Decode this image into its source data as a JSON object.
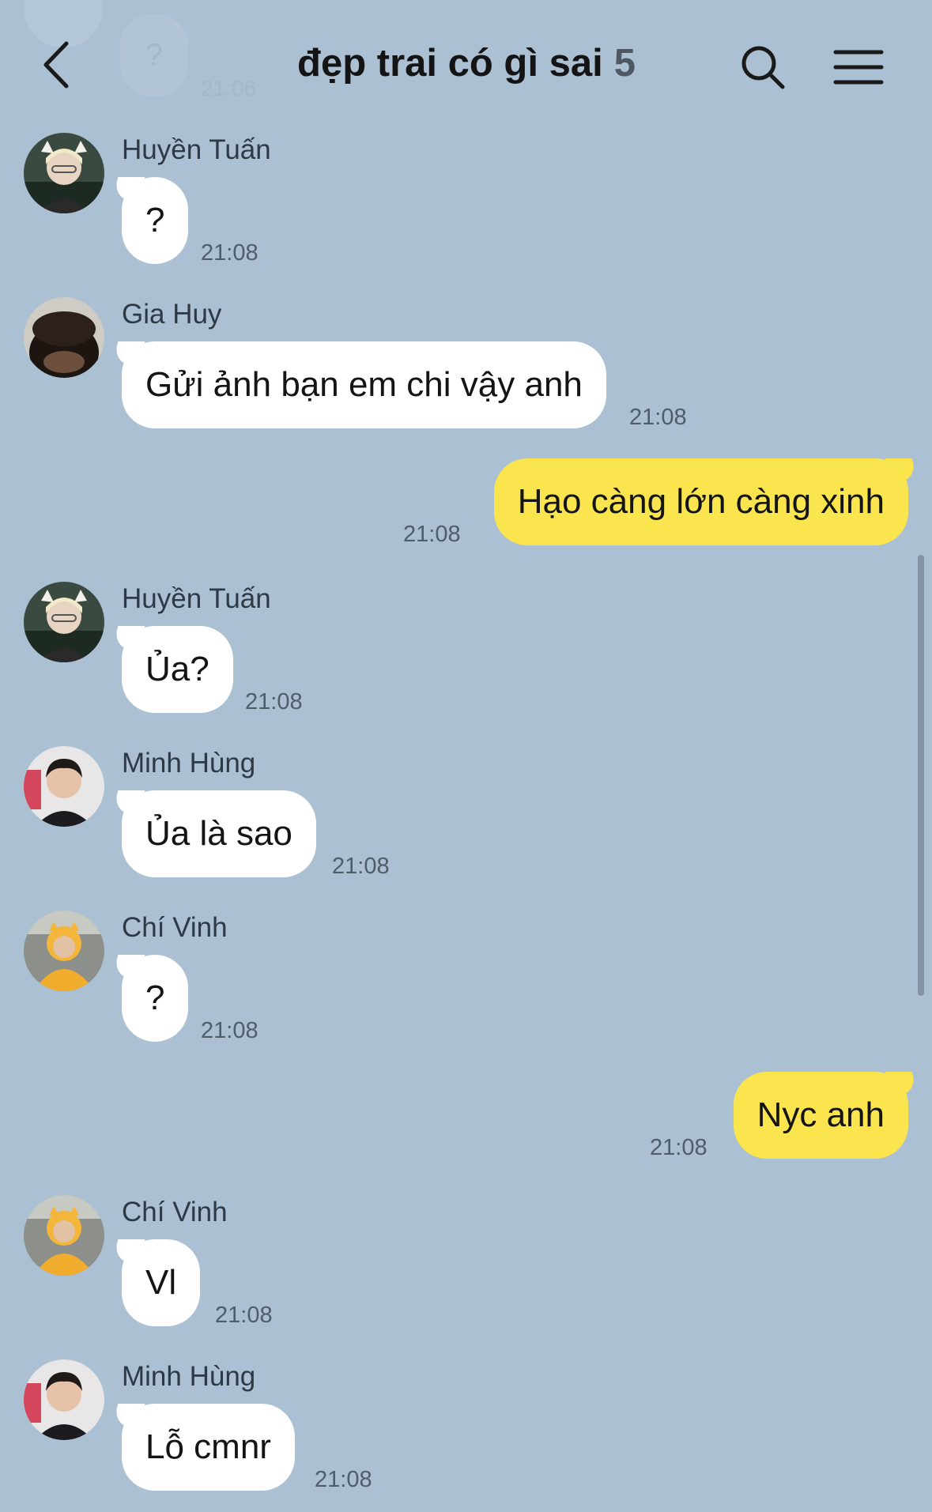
{
  "header": {
    "ghost_bubble_text": "?",
    "ghost_time": "21:06",
    "title": "đẹp trai có gì sai",
    "member_count": "5"
  },
  "messages": [
    {
      "sender": "Huyền Tuấn",
      "text": "?",
      "time": "21:08",
      "outgoing": false
    },
    {
      "sender": "Gia Huy",
      "text": "Gửi ảnh bạn em chi vậy anh",
      "time": "21:08",
      "outgoing": false
    },
    {
      "text": "Hạo càng lớn càng xinh",
      "time": "21:08",
      "outgoing": true
    },
    {
      "sender": "Huyền Tuấn",
      "text": "Ủa?",
      "time": "21:08",
      "outgoing": false
    },
    {
      "sender": "Minh Hùng",
      "text": "Ủa là sao",
      "time": "21:08",
      "outgoing": false
    },
    {
      "sender": "Chí Vinh",
      "text": "?",
      "time": "21:08",
      "outgoing": false
    },
    {
      "text": "Nyc anh",
      "time": "21:08",
      "outgoing": true
    },
    {
      "sender": "Chí Vinh",
      "text": "Vl",
      "time": "21:08",
      "outgoing": false
    },
    {
      "sender": "Minh Hùng",
      "text": "Lỗ cmnr",
      "time": "21:08",
      "outgoing": false
    }
  ],
  "colors": {
    "background": "#abc1d3",
    "incoming_bubble": "#ffffff",
    "outgoing_bubble": "#fae54f"
  }
}
